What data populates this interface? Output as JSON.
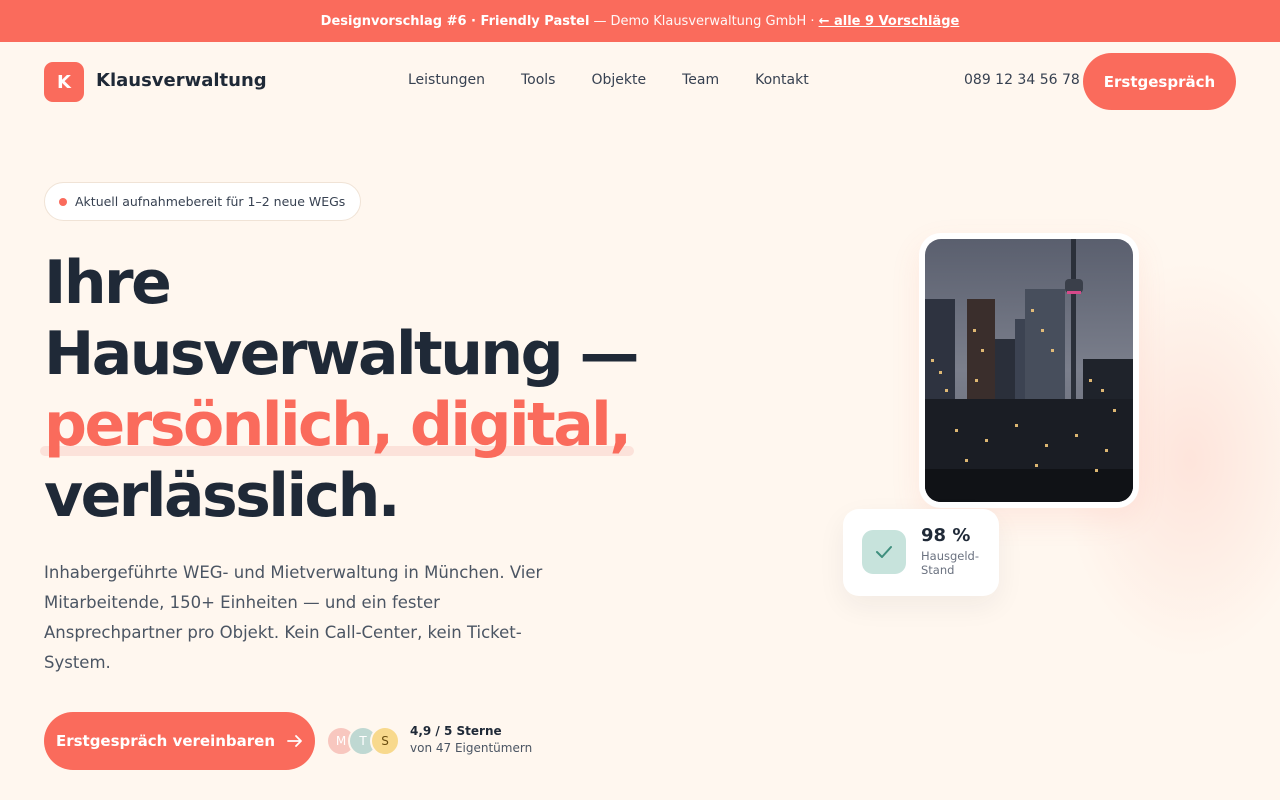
{
  "topbar": {
    "proposal": "Designvorschlag #6 · Friendly Pastel",
    "separator": "—",
    "company": "Demo Klausverwaltung GmbH ·",
    "back_link": "← alle 9 Vorschläge"
  },
  "header": {
    "logo_letter": "K",
    "brand": "Klausverwaltung",
    "nav": [
      "Leistungen",
      "Tools",
      "Objekte",
      "Team",
      "Kontakt"
    ],
    "phone": "089 12 34 56 78",
    "cta": "Erstgespräch"
  },
  "hero": {
    "badge": "Aktuell aufnahmebereit für 1–2 neue WEGs",
    "headline_line1": "Ihre",
    "headline_line2": "Hausverwaltung —",
    "headline_accent": "persönlich, digital,",
    "headline_line4": "verlässlich.",
    "lead": "Inhabergeführte WEG- und Mietverwaltung in München. Vier Mitarbeitende, 150+ Einheiten — und ein fester Ansprechpartner pro Objekt. Kein Call-Center, kein Ticket-System.",
    "cta": "Erstgespräch vereinbaren",
    "avatars": [
      "M",
      "T",
      "S"
    ],
    "rating_title": "4,9 / 5 Sterne",
    "rating_sub": "von 47 Eigentümern"
  },
  "stat": {
    "value": "98 %",
    "label": "Hausgeld-Stand",
    "icon": "check-icon"
  },
  "colors": {
    "accent": "#FA6B5C",
    "background": "#FFF7EF",
    "text": "#1F2937",
    "mint": "#C7E3DC"
  }
}
